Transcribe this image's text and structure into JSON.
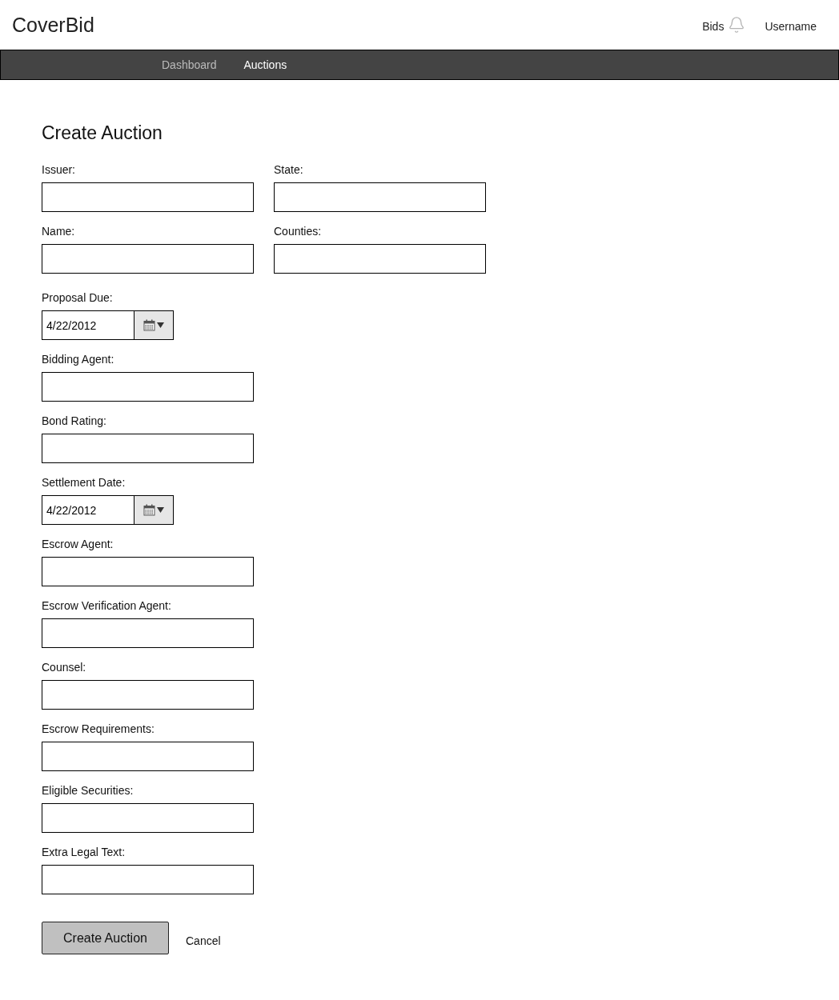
{
  "header": {
    "logo": "CoverBid",
    "bids_link": "Bids",
    "username": "Username"
  },
  "nav": {
    "tabs": [
      {
        "label": "Dashboard",
        "selected": false
      },
      {
        "label": "Auctions",
        "selected": true
      }
    ]
  },
  "form": {
    "title": "Create Auction",
    "rows": [
      {
        "fields": [
          {
            "label": "Issuer:",
            "kind": "text"
          },
          {
            "label": "State:",
            "kind": "text"
          }
        ]
      },
      {
        "fields": [
          {
            "label": "Name:",
            "kind": "text"
          },
          {
            "label": "Counties:",
            "kind": "text"
          }
        ]
      },
      {
        "fields": [
          {
            "label": "Proposal Due:",
            "kind": "date",
            "value": "4/22/2012"
          }
        ]
      },
      {
        "fields": [
          {
            "label": "Bidding Agent:",
            "kind": "text"
          }
        ]
      },
      {
        "fields": [
          {
            "label": "Bond Rating:",
            "kind": "text"
          }
        ]
      },
      {
        "fields": [
          {
            "label": "Settlement Date:",
            "kind": "date",
            "value": "4/22/2012"
          }
        ]
      },
      {
        "fields": [
          {
            "label": "Escrow Agent:",
            "kind": "text"
          }
        ]
      },
      {
        "fields": [
          {
            "label": "Escrow Verification Agent:",
            "kind": "text"
          }
        ]
      },
      {
        "fields": [
          {
            "label": "Counsel:",
            "kind": "text"
          }
        ]
      },
      {
        "fields": [
          {
            "label": "Escrow Requirements:",
            "kind": "text"
          }
        ]
      },
      {
        "fields": [
          {
            "label": "Eligible Securities:",
            "kind": "text"
          }
        ]
      },
      {
        "fields": [
          {
            "label": "Extra Legal Text:",
            "kind": "text"
          }
        ]
      }
    ],
    "actions": {
      "submit": "Create Auction",
      "cancel": "Cancel"
    }
  }
}
